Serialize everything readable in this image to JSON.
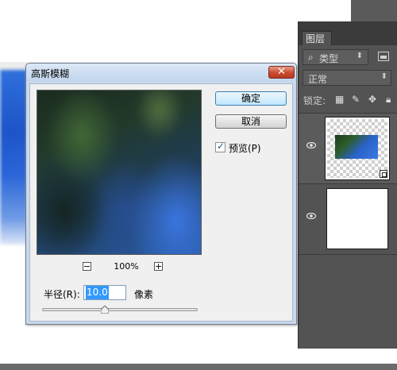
{
  "colors": {
    "dialog_frame": "#c9d9ec",
    "dialog_client": "#f0f0f0",
    "close_button": "#c94a30",
    "panel_bg": "#535353",
    "panel_header": "#3b3b3b",
    "selection": "#3399ff"
  },
  "layers_panel": {
    "tab_label": "图层",
    "filter_kind": {
      "icon": "search-icon",
      "value": "类型"
    },
    "blend_mode": "正常",
    "lock_label": "锁定:",
    "lock_icons": [
      "lock-transparent-icon",
      "lock-brush-icon",
      "lock-move-icon",
      "lock-all-icon"
    ],
    "layers": [
      {
        "name": "smart-object-layer",
        "visible": true,
        "selected": true
      },
      {
        "name": "background-layer",
        "visible": true,
        "selected": false
      }
    ]
  },
  "dialog": {
    "title": "高斯模糊",
    "close_icon": "close-icon",
    "ok_label": "确定",
    "cancel_label": "取消",
    "preview_checkbox": {
      "label": "预览(P)",
      "checked": true
    },
    "zoom": {
      "minus": "−",
      "plus": "+",
      "level": "100%"
    },
    "radius": {
      "label": "半径(R):",
      "value": "10.0",
      "unit": "像素"
    }
  }
}
